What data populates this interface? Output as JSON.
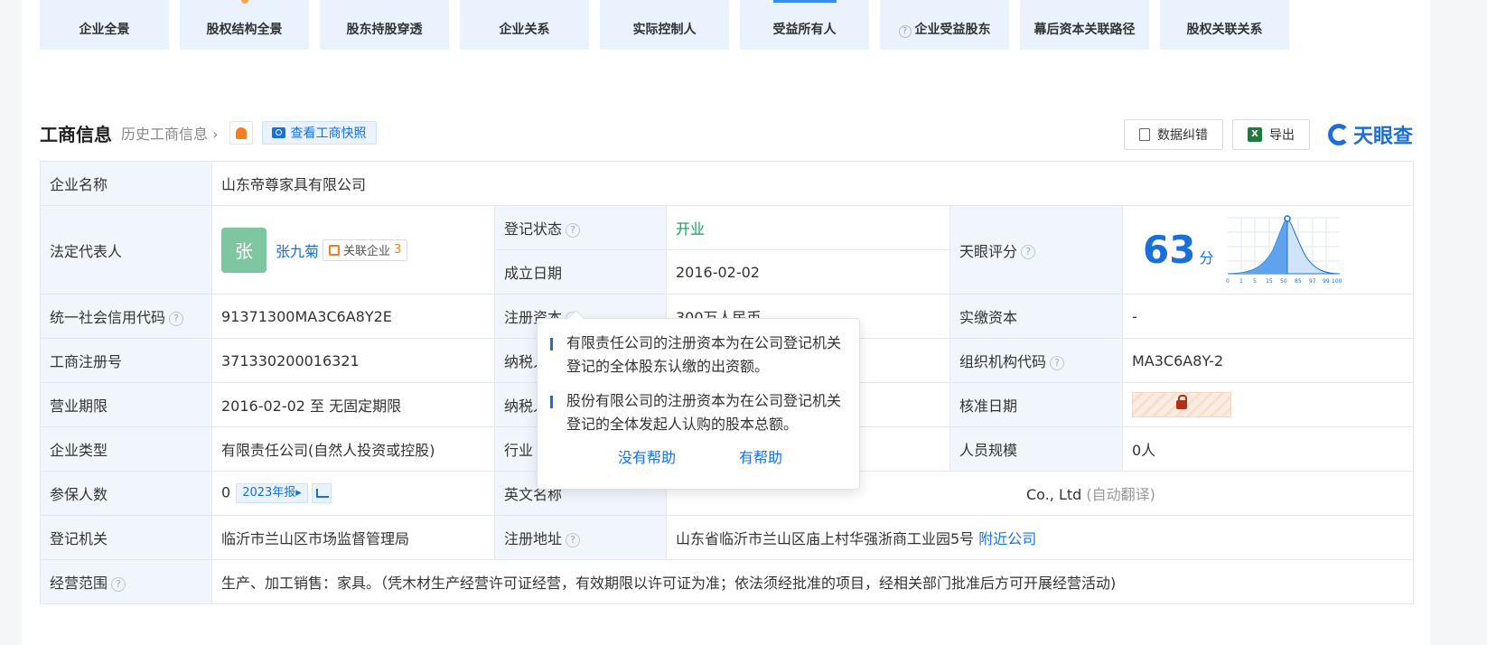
{
  "tabs": [
    {
      "label": "企业全景"
    },
    {
      "label": "股权结构全景"
    },
    {
      "label": "股东持股穿透"
    },
    {
      "label": "企业关系"
    },
    {
      "label": "实际控制人"
    },
    {
      "label": "受益所有人"
    },
    {
      "label": "企业受益股东"
    },
    {
      "label": "幕后资本关联路径"
    },
    {
      "label": "股权关联关系"
    }
  ],
  "section": {
    "title": "工商信息",
    "history_link": "历史工商信息",
    "snapshot_button": "查看工商快照",
    "correction_button": "数据纠错",
    "export_button": "导出",
    "logo_text": "天眼查"
  },
  "info": {
    "company_name_label": "企业名称",
    "company_name": "山东帝尊家具有限公司",
    "legal_rep_label": "法定代表人",
    "legal_rep_avatar": "张",
    "legal_rep_name": "张九菊",
    "related_label": "关联企业",
    "related_count": "3",
    "reg_status_label": "登记状态",
    "reg_status": "开业",
    "founded_label": "成立日期",
    "founded": "2016-02-02",
    "tianyan_score_label": "天眼评分",
    "score": "63",
    "score_unit": "分",
    "credit_code_label": "统一社会信用代码",
    "credit_code": "91371300MA3C6A8Y2E",
    "reg_capital_label": "注册资本",
    "reg_capital": "300万人民币",
    "paid_capital_label": "实缴资本",
    "paid_capital": "-",
    "biz_reg_no_label": "工商注册号",
    "biz_reg_no": "371330200016321",
    "taxpayer_label_1": "纳税人",
    "org_code_label": "组织机构代码",
    "org_code": "MA3C6A8Y-2",
    "biz_term_label": "营业期限",
    "biz_term": "2016-02-02 至 无固定期限",
    "taxpayer_label_2": "纳税人",
    "approval_date_label": "核准日期",
    "company_type_label": "企业类型",
    "company_type": "有限责任公司(自然人投资或控股)",
    "industry_label": "行业",
    "staff_size_label": "人员规模",
    "staff_size": "0人",
    "insured_label": "参保人数",
    "insured_count": "0",
    "insured_year": "2023年报",
    "english_name_label": "英文名称",
    "english_name_tail": "Co., Ltd",
    "auto_translate": "(自动翻译)",
    "registry_label": "登记机关",
    "registry": "临沂市兰山区市场监督管理局",
    "reg_address_label": "注册地址",
    "reg_address": "山东省临沂市兰山区庙上村华强浙商工业园5号",
    "nearby_link": "附近公司",
    "scope_label": "经营范围",
    "scope": "生产、加工销售：家具。（凭木材生产经营许可证经营，有效期限以许可证为准；依法须经批准的项目，经相关部门批准后方可开展经营活动)"
  },
  "score_chart_ticks": [
    "0",
    "1",
    "5",
    "15",
    "50",
    "85",
    "97",
    "99",
    "100"
  ],
  "popover": {
    "para1": "有限责任公司的注册资本为在公司登记机关登记的全体股东认缴的出资额。",
    "para2": "股份有限公司的注册资本为在公司登记机关登记的全体发起人认购的股本总额。",
    "no_help": "没有帮助",
    "helpful": "有帮助"
  },
  "colors": {
    "accent": "#1a6fd8",
    "status_green": "#10a05a",
    "label_bg": "#f1f6fd"
  }
}
